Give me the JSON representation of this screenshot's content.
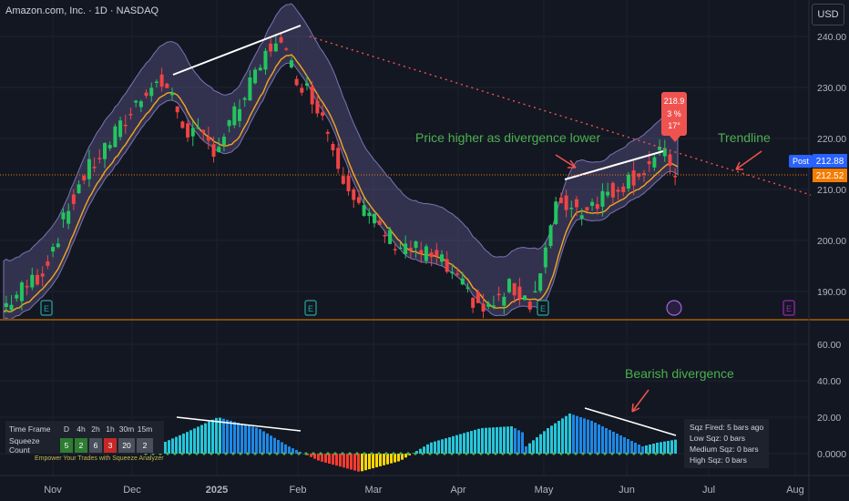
{
  "chart_data": {
    "type": "candlestick",
    "symbol_title": "Amazon.com, Inc. · 1D · NASDAQ",
    "currency": "USD",
    "price_axis": {
      "ticks": [
        "240.00",
        "230.00",
        "220.00",
        "210.00",
        "200.00",
        "190.00"
      ],
      "range": [
        185,
        245
      ]
    },
    "indicator_axis": {
      "ticks": [
        "60.00",
        "40.00",
        "20.00",
        "0.0000"
      ],
      "range": [
        -25,
        65
      ]
    },
    "x_axis": {
      "labels": [
        "Nov",
        "Dec",
        "2025",
        "Feb",
        "Mar",
        "Apr",
        "May",
        "Jun",
        "Jul",
        "Aug"
      ]
    },
    "price_labels": {
      "post_label": "Post",
      "post_value": "212.88",
      "last_value": "212.52"
    },
    "annotations": {
      "callout_price": "218.9",
      "callout_pct": "3 %",
      "callout_angle": "17°",
      "text_divergence": "Price higher as divergence lower",
      "text_trendline": "Trendline",
      "text_bearish": "Bearish divergence",
      "earnings_marker": "E"
    },
    "indicator": {
      "name": "Squeeze Momentum histogram",
      "series_hist_peak_dec": 20,
      "series_hist_peak_feb": 15,
      "series_hist_peak_jun": 22,
      "series_hist_end": 8
    }
  },
  "table": {
    "header_label": "Time Frame",
    "timeframes": [
      "D",
      "4h",
      "2h",
      "1h",
      "30m",
      "15m"
    ],
    "count_label": "Squeeze Count",
    "counts": [
      "5",
      "2",
      "6",
      "3",
      "20",
      "2"
    ],
    "count_colors": [
      "#2e7d32",
      "#2e7d32",
      "#4a4f5c",
      "#c62828",
      "#4a4f5c",
      "#4a4f5c"
    ],
    "footer": "Empower Your Trades with Squeeze Analyzer"
  },
  "squeeze_info": {
    "fired": "Sqz Fired: 5 bars ago",
    "low": "Low Sqz: 0 bars",
    "medium": "Medium Sqz: 0 bars",
    "high": "High Sqz: 0 bars"
  },
  "colors": {
    "up": "#22c55e",
    "down": "#ef4444",
    "band": "#5b5484",
    "ma": "#f5a623",
    "trendline": "#ef5350",
    "annotation_text": "#4caf50",
    "hist_blue": "#1e88e5",
    "hist_cyan": "#26c6da",
    "hist_red": "#ff3b30",
    "hist_yellow": "#ffd600"
  }
}
